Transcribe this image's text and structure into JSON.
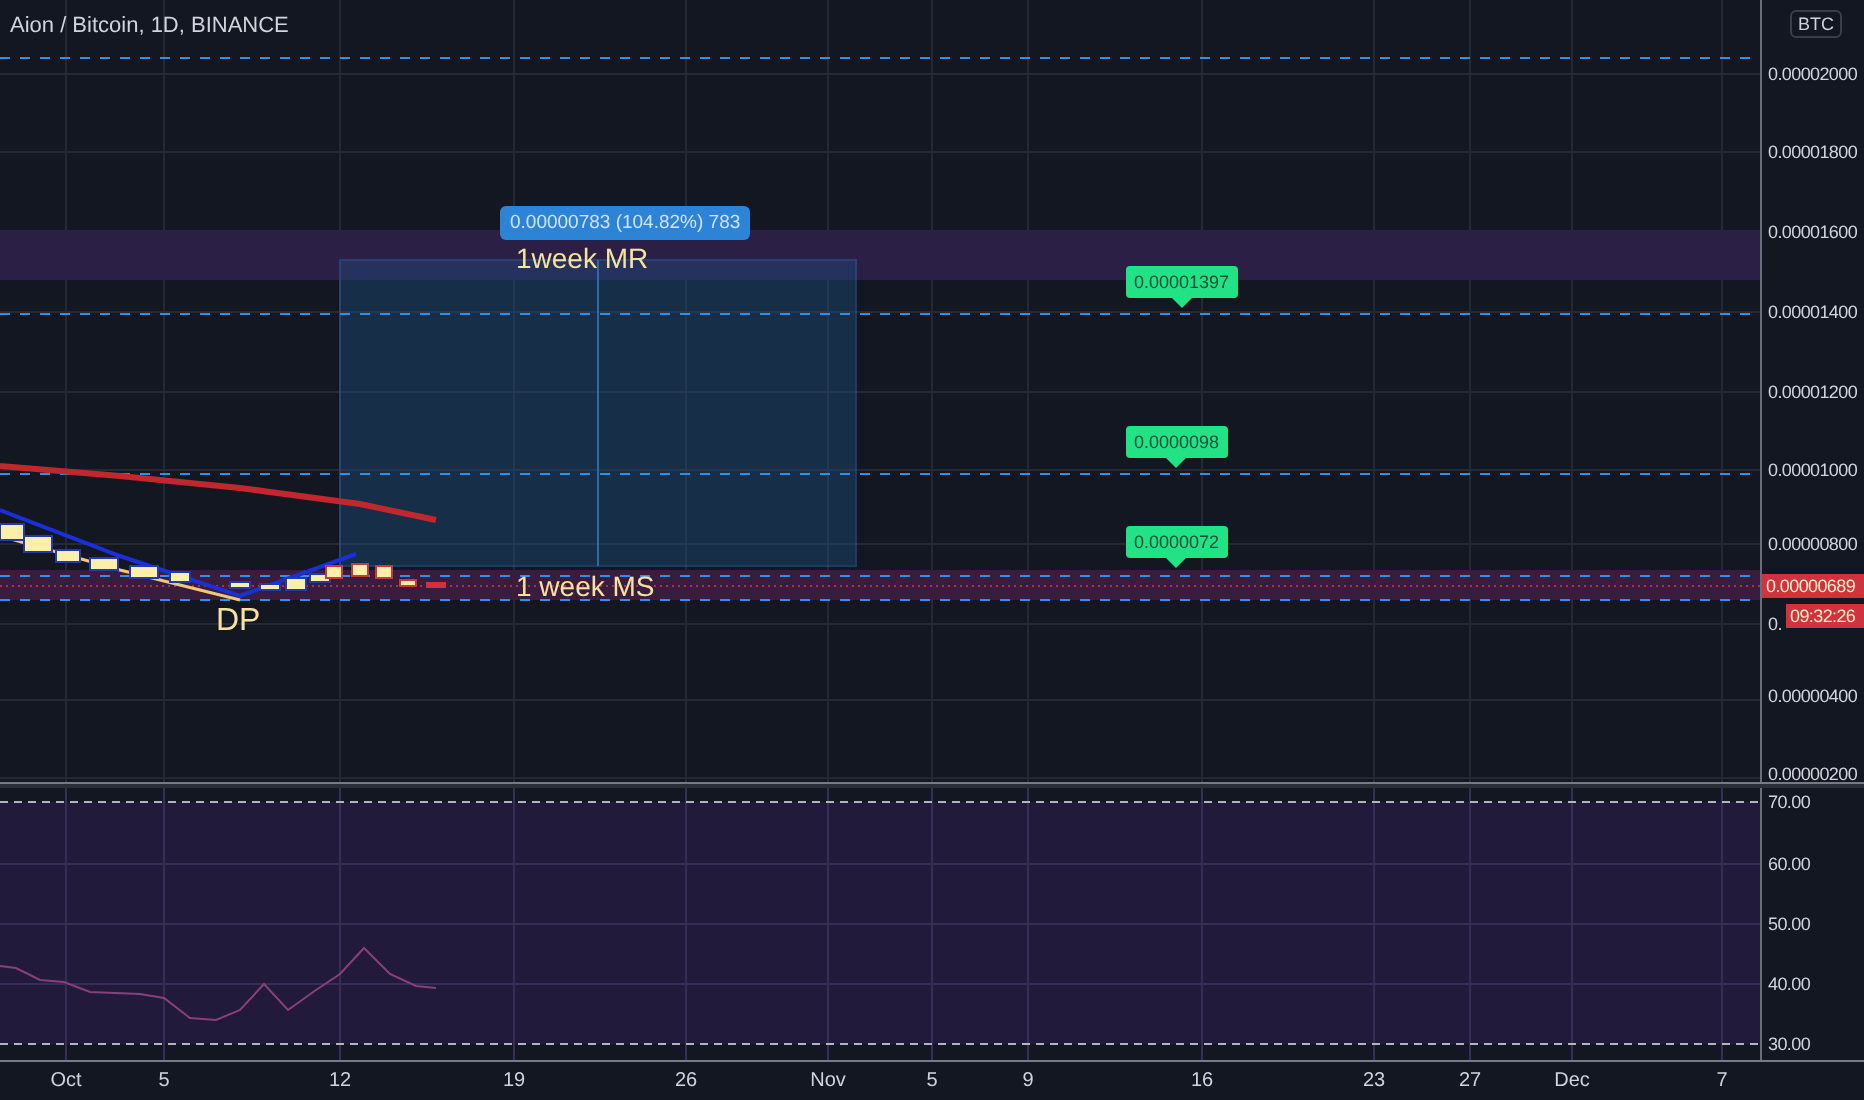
{
  "header": {
    "title": "Aion / Bitcoin, 1D, BINANCE"
  },
  "price_axis": {
    "currency": "BTC",
    "ticks": [
      "0.00002000",
      "0.00001800",
      "0.00001600",
      "0.00001400",
      "0.00001200",
      "0.00001000",
      "0.00000800"
    ],
    "lower_ticks": [
      "0.00000400",
      "0.00000200"
    ],
    "covered_tick": "0.",
    "last_price": "0.00000689",
    "countdown": "09:32:26"
  },
  "annotations": {
    "measure_label": "0.00000783 (104.82%) 783",
    "resistance_label": "1week MR",
    "support_label": "1 week MS",
    "point_label": "DP",
    "price_tags": [
      {
        "text": "0.00001397"
      },
      {
        "text": "0.0000098"
      },
      {
        "text": "0.0000072"
      }
    ]
  },
  "rsi_axis": {
    "ticks": [
      "70.00",
      "60.00",
      "50.00",
      "40.00",
      "30.00"
    ]
  },
  "time_axis": {
    "ticks": [
      "Oct",
      "5",
      "12",
      "19",
      "26",
      "Nov",
      "5",
      "9",
      "16",
      "23",
      "27",
      "Dec",
      "7"
    ]
  }
}
